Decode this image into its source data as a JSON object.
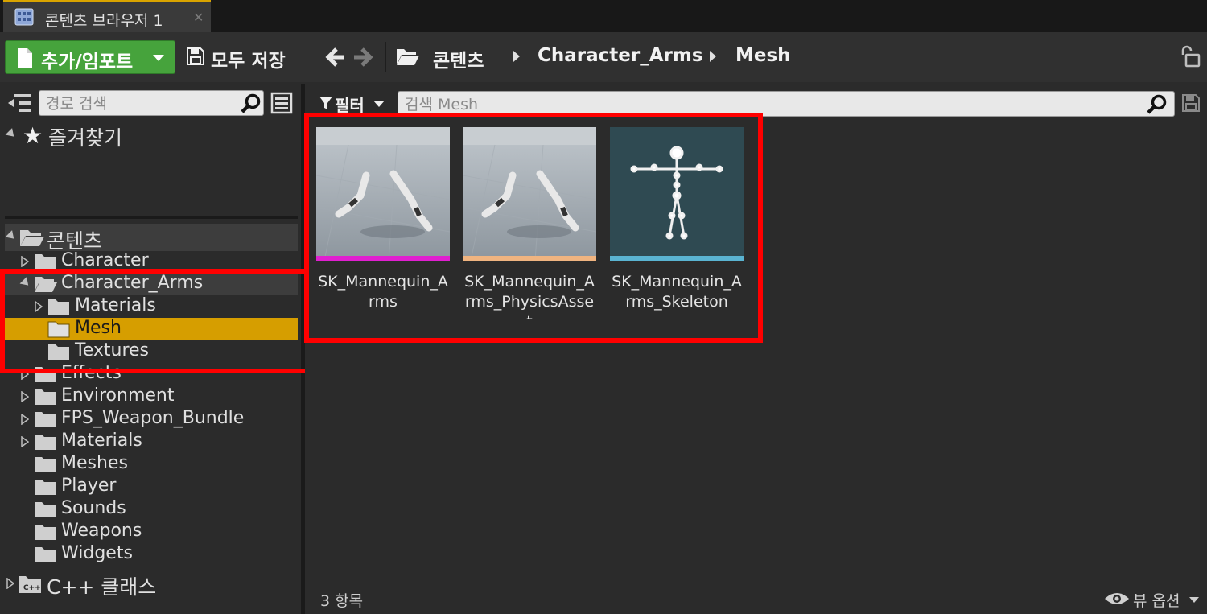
{
  "tab": {
    "title": "콘텐츠 브라우저 1",
    "close": "✕"
  },
  "toolbar": {
    "add_import_label": "추가/임포트",
    "save_all_label": "모두 저장",
    "breadcrumb": [
      "콘텐츠",
      "Character_Arms",
      "Mesh"
    ]
  },
  "sources": {
    "search_placeholder": "경로 검색",
    "favorites_label": "즐겨찾기",
    "content_root_label": "콘텐츠",
    "cpp_label": "C++ 클래스",
    "tree": [
      {
        "label": "Character",
        "has_children": true
      },
      {
        "label": "Character_Arms",
        "expanded": true
      },
      {
        "label": "Materials",
        "has_children": true,
        "child": true
      },
      {
        "label": "Mesh",
        "selected": true,
        "child": true
      },
      {
        "label": "Textures",
        "child": true
      },
      {
        "label": "Effects",
        "has_children": true
      },
      {
        "label": "Environment",
        "has_children": true
      },
      {
        "label": "FPS_Weapon_Bundle",
        "has_children": true
      },
      {
        "label": "Materials",
        "has_children": true
      },
      {
        "label": "Meshes"
      },
      {
        "label": "Player"
      },
      {
        "label": "Sounds"
      },
      {
        "label": "Weapons"
      },
      {
        "label": "Widgets"
      }
    ]
  },
  "assets": {
    "filter_label": "필터",
    "search_placeholder": "검색 Mesh",
    "items": [
      {
        "name": "SK_Mannequin_Arms",
        "bar_color": "#e020d0"
      },
      {
        "name": "SK_Mannequin_Arms_PhysicsAsset",
        "bar_color": "#f0b480"
      },
      {
        "name": "SK_Mannequin_Arms_Skeleton",
        "bar_color": "#5ab4d2"
      }
    ],
    "item_count": "3 항목",
    "view_options_label": "뷰 옵션"
  },
  "colors": {
    "accent_selected": "#d69e00",
    "highlight_box": "#ff0000",
    "add_button": "#46a33c"
  }
}
